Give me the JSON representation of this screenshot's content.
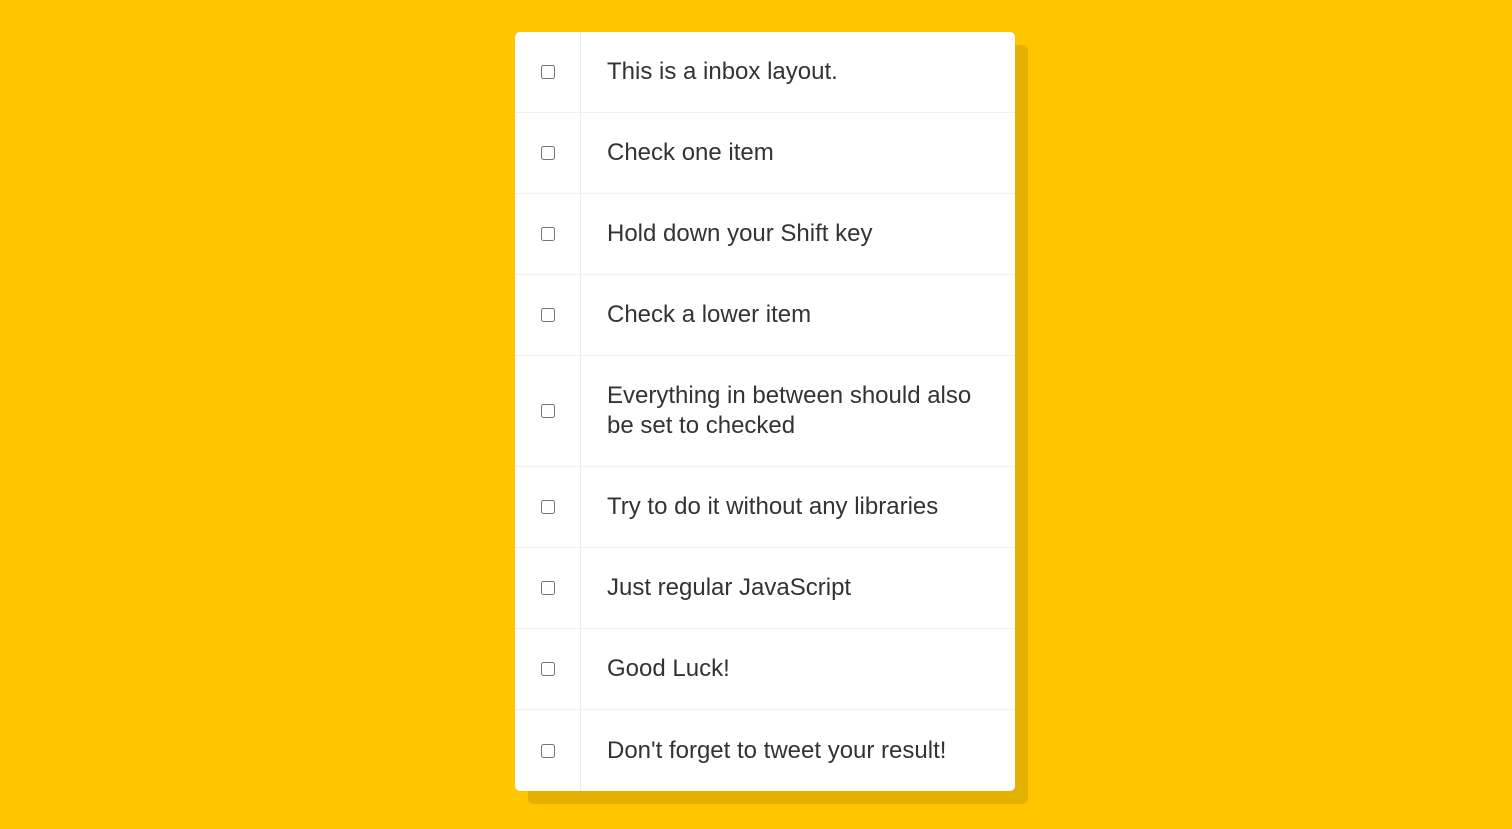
{
  "theme": {
    "background": "#ffc600",
    "card": "#ffffff",
    "text": "#333333"
  },
  "inbox": {
    "items": [
      {
        "label": "This is a inbox layout.",
        "checked": false
      },
      {
        "label": "Check one item",
        "checked": false
      },
      {
        "label": "Hold down your Shift key",
        "checked": false
      },
      {
        "label": "Check a lower item",
        "checked": false
      },
      {
        "label": "Everything in between should also be set to checked",
        "checked": false
      },
      {
        "label": "Try to do it without any libraries",
        "checked": false
      },
      {
        "label": "Just regular JavaScript",
        "checked": false
      },
      {
        "label": "Good Luck!",
        "checked": false
      },
      {
        "label": "Don't forget to tweet your result!",
        "checked": false
      }
    ]
  }
}
